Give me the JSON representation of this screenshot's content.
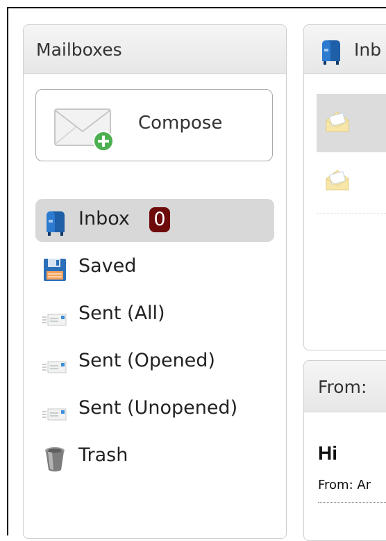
{
  "mailboxes": {
    "title": "Mailboxes",
    "compose_label": "Compose",
    "items": [
      {
        "label": "Inbox",
        "icon": "mailbox-icon",
        "badge": "0",
        "active": true
      },
      {
        "label": "Saved",
        "icon": "floppy-disk-icon"
      },
      {
        "label": "Sent (All)",
        "icon": "sent-letter-icon"
      },
      {
        "label": "Sent (Opened)",
        "icon": "sent-letter-icon"
      },
      {
        "label": "Sent (Unopened)",
        "icon": "sent-letter-icon"
      },
      {
        "label": "Trash",
        "icon": "trash-can-icon"
      }
    ]
  },
  "inbox_panel": {
    "title": "Inb",
    "icon": "mailbox-icon"
  },
  "message_panel": {
    "header": "From: ",
    "subject": "Hi",
    "from_line": "From: Ar"
  },
  "colors": {
    "badge": "#6d0a0a",
    "active_row": "#d8d8d8",
    "panel_header": "#e9e9e9",
    "mailbox_blue": "#1f5fa8"
  }
}
